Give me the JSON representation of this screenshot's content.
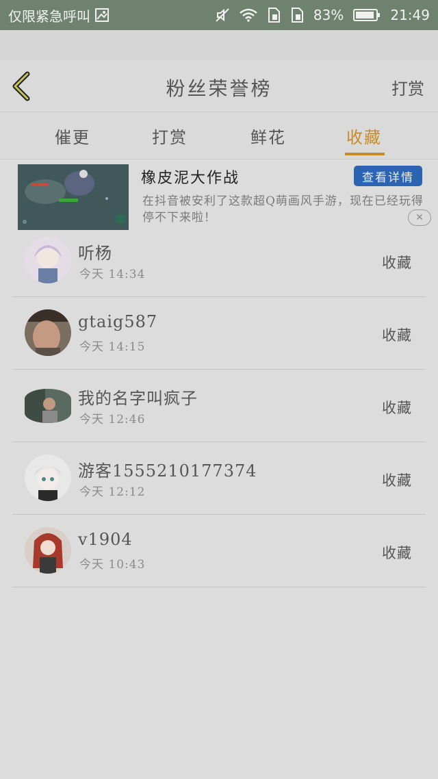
{
  "status_bar": {
    "carrier": "仅限紧急呼叫",
    "battery": "83%",
    "time": "21:49"
  },
  "header": {
    "title": "粉丝荣誉榜",
    "right_action": "打赏"
  },
  "tabs": [
    {
      "label": "催更"
    },
    {
      "label": "打赏"
    },
    {
      "label": "鲜花"
    },
    {
      "label": "收藏"
    }
  ],
  "active_tab": "收藏",
  "ad": {
    "title": "橡皮泥大作战",
    "button": "查看详情",
    "description": "在抖音被安利了这款超Q萌画风手游，现在已经玩得停不下来啦！"
  },
  "fans": [
    {
      "name": "听杨",
      "time": "今天 14:34",
      "action": "收藏"
    },
    {
      "name": "gtaig587",
      "time": "今天 14:15",
      "action": "收藏"
    },
    {
      "name": "我的名字叫疯子",
      "time": "今天 12:46",
      "action": "收藏"
    },
    {
      "name": "游客1555210177374",
      "time": "今天 12:12",
      "action": "收藏"
    },
    {
      "name": "v1904",
      "time": "今天 10:43",
      "action": "收藏"
    }
  ],
  "colors": {
    "accent": "#c88c24",
    "ad_button": "#2c64b4",
    "status_bar": "#6f8270"
  }
}
